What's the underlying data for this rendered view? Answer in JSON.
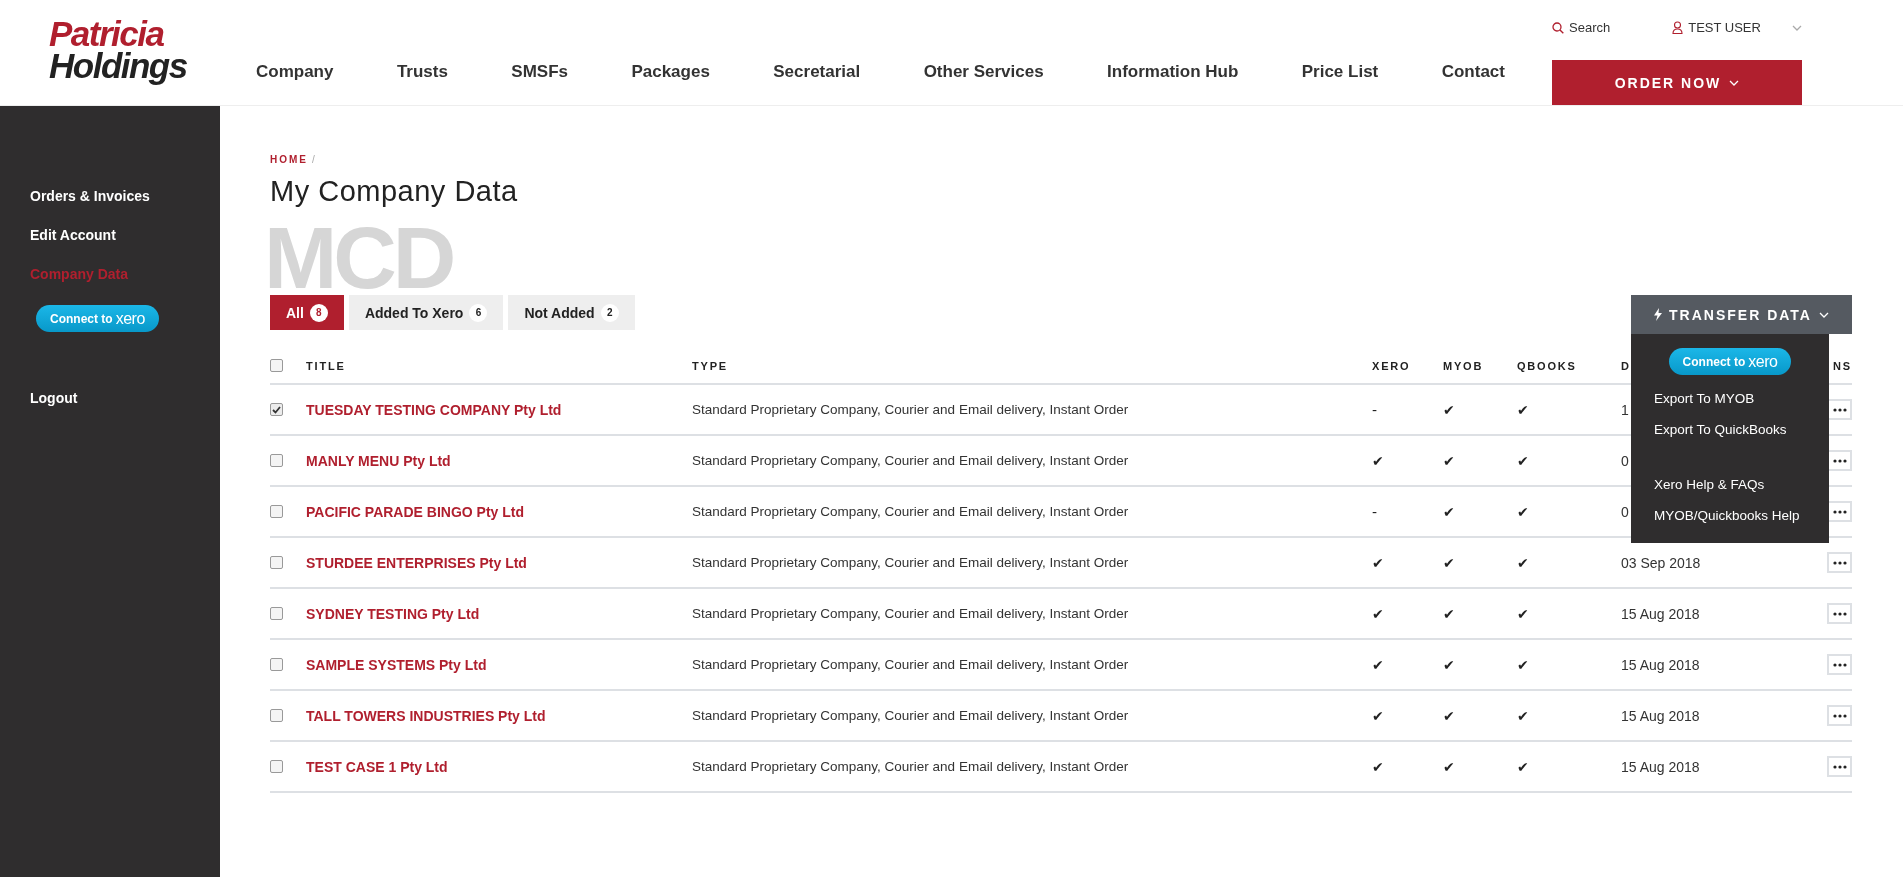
{
  "logo": {
    "line_1": "Patricia",
    "line_2": "Holdings"
  },
  "nav": [
    "Company",
    "Trusts",
    "SMSFs",
    "Packages",
    "Secretarial",
    "Other Services",
    "Information Hub",
    "Price List",
    "Contact"
  ],
  "top_links": {
    "search": "Search",
    "user": "TEST USER"
  },
  "order_button": "ORDER NOW",
  "sidebar": {
    "items": [
      {
        "label": "Orders & Invoices",
        "selected": false
      },
      {
        "label": "Edit Account",
        "selected": false
      },
      {
        "label": "Company Data",
        "selected": true
      }
    ],
    "xero_button": {
      "label": "Connect to",
      "brand": "xero"
    },
    "logout": "Logout"
  },
  "page": {
    "watermark": "MCD",
    "breadcrumb": "HOME",
    "separator": "/",
    "title": "My Company Data"
  },
  "tabs": [
    {
      "label": "All",
      "count": "8",
      "selected": true
    },
    {
      "label": "Added To Xero",
      "count": "6",
      "selected": false
    },
    {
      "label": "Not Added",
      "count": "2",
      "selected": false
    }
  ],
  "transfer": {
    "label": "TRANSFER DATA",
    "expanded": true,
    "menu": [
      {
        "kind": "xero",
        "label": "Connect to",
        "brand": "xero"
      },
      {
        "kind": "link",
        "label": "Export To MYOB"
      },
      {
        "kind": "link",
        "label": "Export To QuickBooks"
      },
      {
        "kind": "gap"
      },
      {
        "kind": "link",
        "label": "Xero Help & FAQs"
      },
      {
        "kind": "link",
        "label": "MYOB/Quickbooks Help"
      }
    ]
  },
  "table": {
    "select_all_checked": false,
    "columns": [
      "TITLE",
      "TYPE",
      "XERO",
      "MYOB",
      "QBOOKS",
      "D",
      "NS"
    ],
    "rows": [
      {
        "checked": true,
        "title": "TUESDAY TESTING COMPANY Pty Ltd",
        "type": "Standard Proprietary Company, Courier and Email delivery, Instant Order",
        "xero": "-",
        "myob": "✔",
        "qbooks": "✔",
        "date": "1"
      },
      {
        "checked": false,
        "title": "MANLY MENU Pty Ltd",
        "type": "Standard Proprietary Company, Courier and Email delivery, Instant Order",
        "xero": "✔",
        "myob": "✔",
        "qbooks": "✔",
        "date": "0"
      },
      {
        "checked": false,
        "title": "PACIFIC PARADE BINGO Pty Ltd",
        "type": "Standard Proprietary Company, Courier and Email delivery, Instant Order",
        "xero": "-",
        "myob": "✔",
        "qbooks": "✔",
        "date": "0"
      },
      {
        "checked": false,
        "title": "STURDEE ENTERPRISES Pty Ltd",
        "type": "Standard Proprietary Company, Courier and Email delivery, Instant Order",
        "xero": "✔",
        "myob": "✔",
        "qbooks": "✔",
        "date": "03 Sep 2018"
      },
      {
        "checked": false,
        "title": "SYDNEY TESTING Pty Ltd",
        "type": "Standard Proprietary Company, Courier and Email delivery, Instant Order",
        "xero": "✔",
        "myob": "✔",
        "qbooks": "✔",
        "date": "15 Aug 2018"
      },
      {
        "checked": false,
        "title": "SAMPLE SYSTEMS Pty Ltd",
        "type": "Standard Proprietary Company, Courier and Email delivery, Instant Order",
        "xero": "✔",
        "myob": "✔",
        "qbooks": "✔",
        "date": "15 Aug 2018"
      },
      {
        "checked": false,
        "title": "TALL TOWERS INDUSTRIES Pty Ltd",
        "type": "Standard Proprietary Company, Courier and Email delivery, Instant Order",
        "xero": "✔",
        "myob": "✔",
        "qbooks": "✔",
        "date": "15 Aug 2018"
      },
      {
        "checked": false,
        "title": "TEST CASE 1 Pty Ltd",
        "type": "Standard Proprietary Company, Courier and Email delivery, Instant Order",
        "xero": "✔",
        "myob": "✔",
        "qbooks": "✔",
        "date": "15 Aug 2018"
      }
    ]
  }
}
